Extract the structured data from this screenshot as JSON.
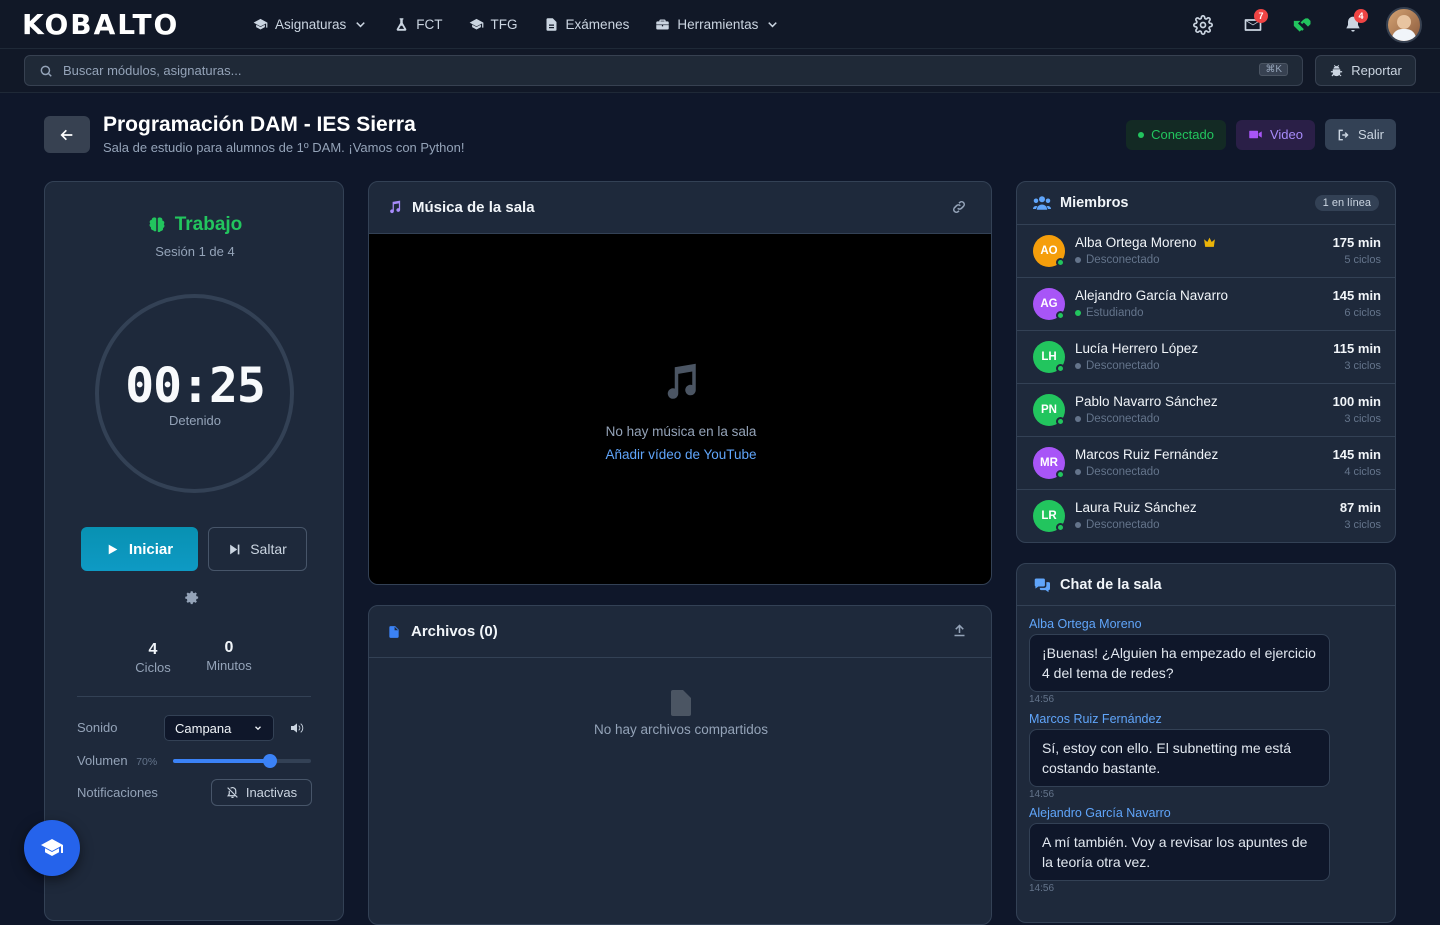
{
  "app": {
    "logo": "KOBALTO"
  },
  "nav": [
    {
      "label": "Asignaturas",
      "icon": "graduation-cap-icon",
      "dropdown": true
    },
    {
      "label": "FCT",
      "icon": "flask-icon",
      "dropdown": false
    },
    {
      "label": "TFG",
      "icon": "graduation-cap-icon",
      "dropdown": false
    },
    {
      "label": "Exámenes",
      "icon": "document-icon",
      "dropdown": false
    },
    {
      "label": "Herramientas",
      "icon": "toolbox-icon",
      "dropdown": true
    }
  ],
  "topbar": {
    "mail_badge": "7",
    "bell_badge": "4"
  },
  "search": {
    "placeholder": "Buscar módulos, asignaturas...",
    "shortcut": "⌘K"
  },
  "report": {
    "label": "Reportar"
  },
  "room": {
    "title": "Programación DAM - IES Sierra",
    "subtitle": "Sala de estudio para alumnos de 1º DAM. ¡Vamos con Python!",
    "status": "Conectado",
    "video": "Video",
    "exit": "Salir"
  },
  "timer": {
    "mode": "Trabajo",
    "session": "Sesión 1 de 4",
    "time": "00:25",
    "state": "Detenido",
    "start": "Iniciar",
    "skip": "Saltar",
    "cycles_value": "4",
    "cycles_label": "Ciclos",
    "minutes_value": "0",
    "minutes_label": "Minutos",
    "sound_label": "Sonido",
    "sound_value": "Campana",
    "volume_label": "Volumen",
    "volume_value": "70%",
    "volume_level": 0.7,
    "notif_label": "Notificaciones",
    "notif_value": "Inactivas",
    "accent": "#22c55e"
  },
  "music": {
    "title": "Música de la sala",
    "empty": "No hay música en la sala",
    "add": "Añadir vídeo de YouTube"
  },
  "files": {
    "title": "Archivos (0)",
    "empty": "No hay archivos compartidos"
  },
  "members": {
    "title": "Miembros",
    "online": "1 en línea",
    "list": [
      {
        "initials": "AO",
        "name": "Alba Ortega Moreno",
        "status": "Desconectado",
        "minutes": "175 min",
        "cycles": "5 ciclos",
        "color": "#f59e0b",
        "owner": true
      },
      {
        "initials": "AG",
        "name": "Alejandro García Navarro",
        "status": "Estudiando",
        "minutes": "145 min",
        "cycles": "6 ciclos",
        "color": "#a855f7",
        "owner": false
      },
      {
        "initials": "LH",
        "name": "Lucía Herrero López",
        "status": "Desconectado",
        "minutes": "115 min",
        "cycles": "3 ciclos",
        "color": "#22c55e",
        "owner": false
      },
      {
        "initials": "PN",
        "name": "Pablo Navarro Sánchez",
        "status": "Desconectado",
        "minutes": "100 min",
        "cycles": "3 ciclos",
        "color": "#22c55e",
        "owner": false
      },
      {
        "initials": "MR",
        "name": "Marcos Ruiz Fernández",
        "status": "Desconectado",
        "minutes": "145 min",
        "cycles": "4 ciclos",
        "color": "#a855f7",
        "owner": false
      },
      {
        "initials": "LR",
        "name": "Laura Ruiz Sánchez",
        "status": "Desconectado",
        "minutes": "87 min",
        "cycles": "3 ciclos",
        "color": "#22c55e",
        "owner": false
      }
    ]
  },
  "chat": {
    "title": "Chat de la sala",
    "messages": [
      {
        "author": "Alba Ortega Moreno",
        "text": "¡Buenas! ¿Alguien ha empezado el ejercicio 4 del tema de redes?",
        "time": "14:56"
      },
      {
        "author": "Marcos Ruiz Fernández",
        "text": "Sí, estoy con ello. El subnetting me está costando bastante.",
        "time": "14:56"
      },
      {
        "author": "Alejandro García Navarro",
        "text": "A mí también. Voy a revisar los apuntes de la teoría otra vez.",
        "time": "14:56"
      }
    ]
  }
}
